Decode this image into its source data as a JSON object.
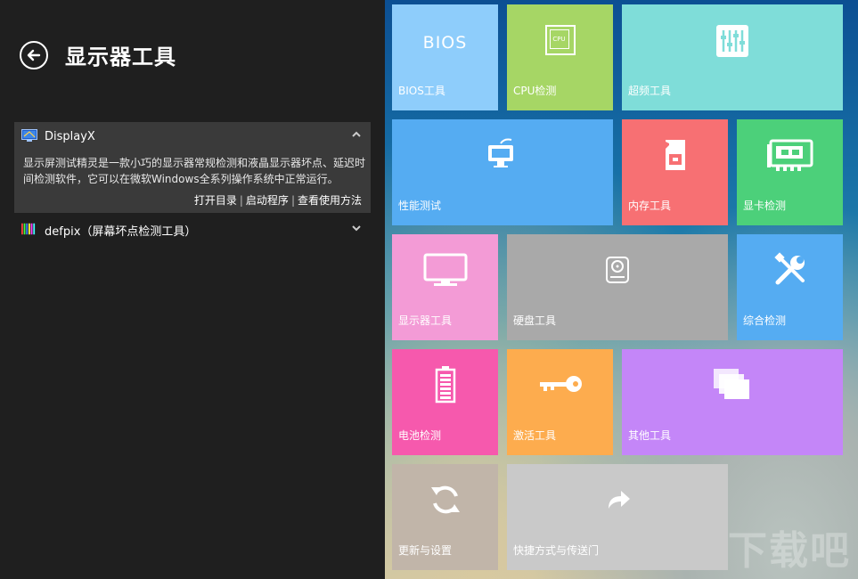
{
  "header": {
    "title": "显示器工具",
    "back_icon": "back-arrow-circle-icon"
  },
  "items": [
    {
      "title": "DisplayX",
      "expanded": true,
      "icon": "monitor-app-icon",
      "description": "显示屏测试精灵是一款小巧的显示器常规检测和液晶显示器坏点、延迟时间检测软件，它可以在微软Windows全系列操作系统中正常运行。",
      "links": [
        "打开目录",
        "启动程序",
        "查看使用方法"
      ],
      "chevron": "chevron-up-icon"
    },
    {
      "title": "defpix（屏幕坏点检测工具）",
      "expanded": false,
      "icon": "color-bars-app-icon",
      "chevron": "chevron-down-icon"
    }
  ],
  "tiles": [
    {
      "label": "BIOS工具",
      "icon_text": "BIOS",
      "color": "#8ecdfb"
    },
    {
      "label": "CPU检测",
      "icon_text": "CPU",
      "color": "#a6d665"
    },
    {
      "label": "超频工具",
      "color": "#7fddd9"
    },
    {
      "label": "性能测试",
      "color": "#55acf2"
    },
    {
      "label": "内存工具",
      "color": "#f77073"
    },
    {
      "label": "显卡检测",
      "color": "#4cd07a"
    },
    {
      "label": "显示器工具",
      "color": "#f39bd6"
    },
    {
      "label": "硬盘工具",
      "color": "#a9a9a9"
    },
    {
      "label": "综合检测",
      "color": "#55acf2"
    },
    {
      "label": "电池检测",
      "color": "#f659ad"
    },
    {
      "label": "激活工具",
      "color": "#fdac4e"
    },
    {
      "label": "其他工具",
      "color": "#c486f8"
    },
    {
      "label": "更新与设置",
      "color": "#c1b5a9"
    },
    {
      "label": "快捷方式与传送门",
      "color": "#c9c9c9"
    }
  ],
  "watermark": "下载吧"
}
